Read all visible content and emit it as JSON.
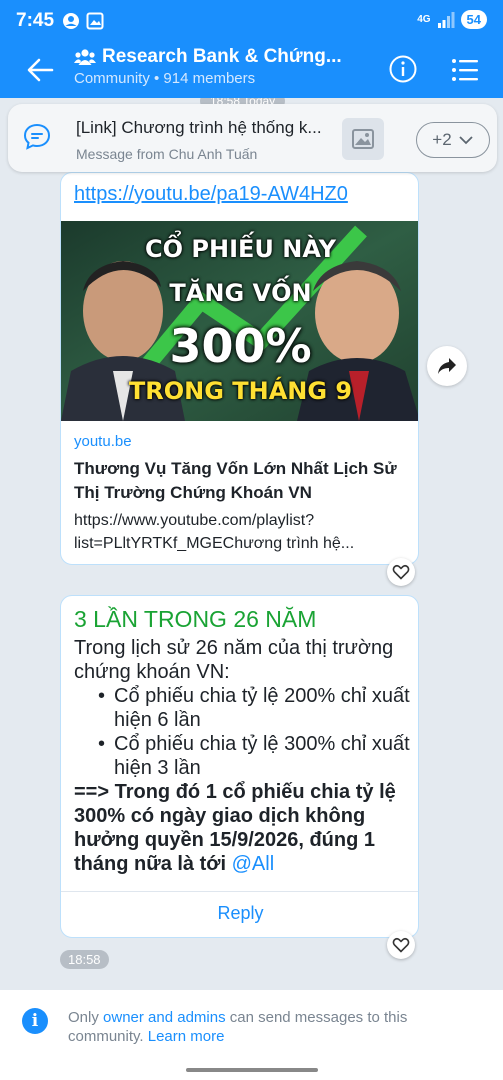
{
  "status": {
    "time": "7:45",
    "network": "4G",
    "battery": "54"
  },
  "header": {
    "title": "Research Bank & Chứng...",
    "subtitle": "Community • 914 members",
    "icons": [
      "back-arrow-icon",
      "community-icon",
      "info-icon",
      "list-menu-icon"
    ]
  },
  "chat": {
    "top_time": "18:58 Today",
    "pinned": {
      "title": "[Link] Chương trình hệ thống k...",
      "subtitle": "Message from Chu Anh Tuấn",
      "more": "+2"
    },
    "link_card": {
      "url": "https://youtu.be/pa19-AW4HZ0",
      "thumb_lines": [
        "CỔ PHIẾU NÀY",
        "TĂNG VỐN",
        "300%",
        "TRONG THÁNG 9"
      ],
      "domain": "youtu.be",
      "video_title": "Thương Vụ Tăng Vốn Lớn Nhất Lịch Sử Thị Trường Chứng Khoán VN",
      "video_desc": "https://www.youtube.com/playlist?list=PLltYRTKf_MGEChương trình hệ..."
    },
    "text_card": {
      "heading": "3 LẦN TRONG 26 NĂM",
      "intro": "Trong lịch sử 26 năm của thị trường chứng khoán VN:",
      "bullets": [
        "Cổ phiếu chia tỷ lệ 200% chỉ xuất hiện 6 lần",
        "Cổ phiếu chia tỷ lệ 300% chỉ xuất hiện 3 lần"
      ],
      "conclusion": "==> Trong đó 1 cổ phiếu chia tỷ lệ 300% có ngày giao dịch không hưởng quyền 15/9/2026, đúng 1 tháng nữa là tới",
      "mention": "@All",
      "reply": "Reply"
    },
    "bottom_time": "18:58"
  },
  "footer": {
    "pre": "Only ",
    "highlight": "owner and admins",
    "mid": " can send messages to this community. ",
    "learn_more": "Learn more"
  },
  "colors": {
    "primary": "#1a8ffd",
    "heading_green": "#1aa334",
    "chat_bg": "#e4eaf0"
  }
}
